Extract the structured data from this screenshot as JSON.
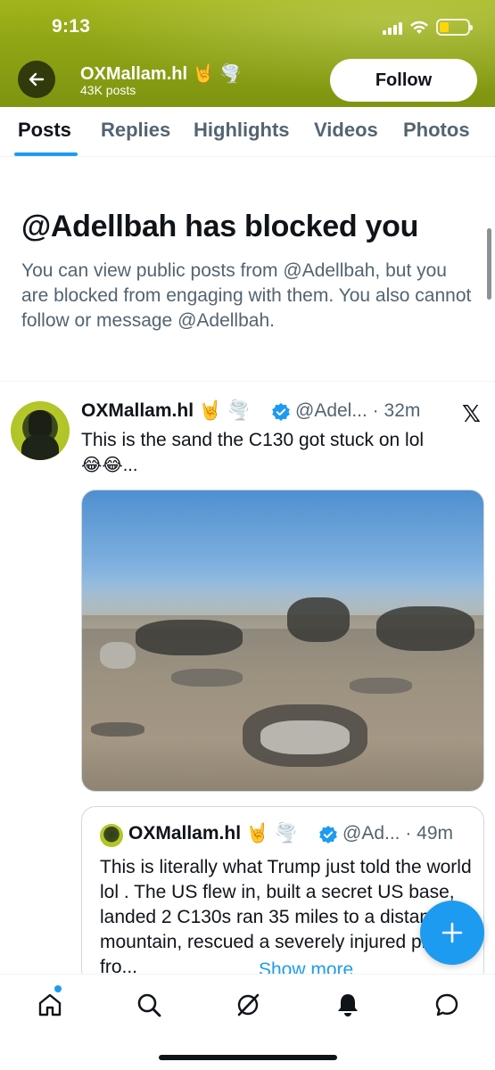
{
  "status_bar": {
    "time": "9:13"
  },
  "header": {
    "profile_name": "OXMallam.hl",
    "name_emojis": [
      "🤘",
      "🌪️"
    ],
    "post_count": "43K posts",
    "follow_label": "Follow",
    "banner_color": "#8fa514"
  },
  "tabs": [
    {
      "label": "Posts",
      "active": true
    },
    {
      "label": "Replies",
      "active": false
    },
    {
      "label": "Highlights",
      "active": false
    },
    {
      "label": "Videos",
      "active": false
    },
    {
      "label": "Photos",
      "active": false
    }
  ],
  "blocked_notice": {
    "title": "@Adellbah has blocked you",
    "body": "You can view public posts from @Adellbah, but you are blocked from engaging with them. You also cannot follow or message @Adellbah."
  },
  "tweet": {
    "author": "OXMallam.hl",
    "author_emojis": [
      "🤘",
      "🌪️"
    ],
    "handle_time": "@Adel... · 32m",
    "text": "This is the sand the C130 got stuck on lol",
    "text_emojis": "😂😂...",
    "source_icon": "x-logo"
  },
  "quote_tweet": {
    "author": "OXMallam.hl",
    "author_emojis": [
      "🤘",
      "🌪️"
    ],
    "handle_time": "@Ad... · 49m",
    "text": "This is literally what Trump just told the world lol . The US flew in, built a secret US base, landed 2 C130s ran 35 miles to a distant mountain, rescued a severely injured pilot fro...",
    "show_more": "Show more"
  },
  "bottom_nav": [
    "home-icon",
    "search-icon",
    "grok-icon",
    "notifications-icon",
    "messages-icon"
  ],
  "colors": {
    "accent": "#1d9bf0",
    "text": "#0f1419",
    "muted": "#536471"
  }
}
